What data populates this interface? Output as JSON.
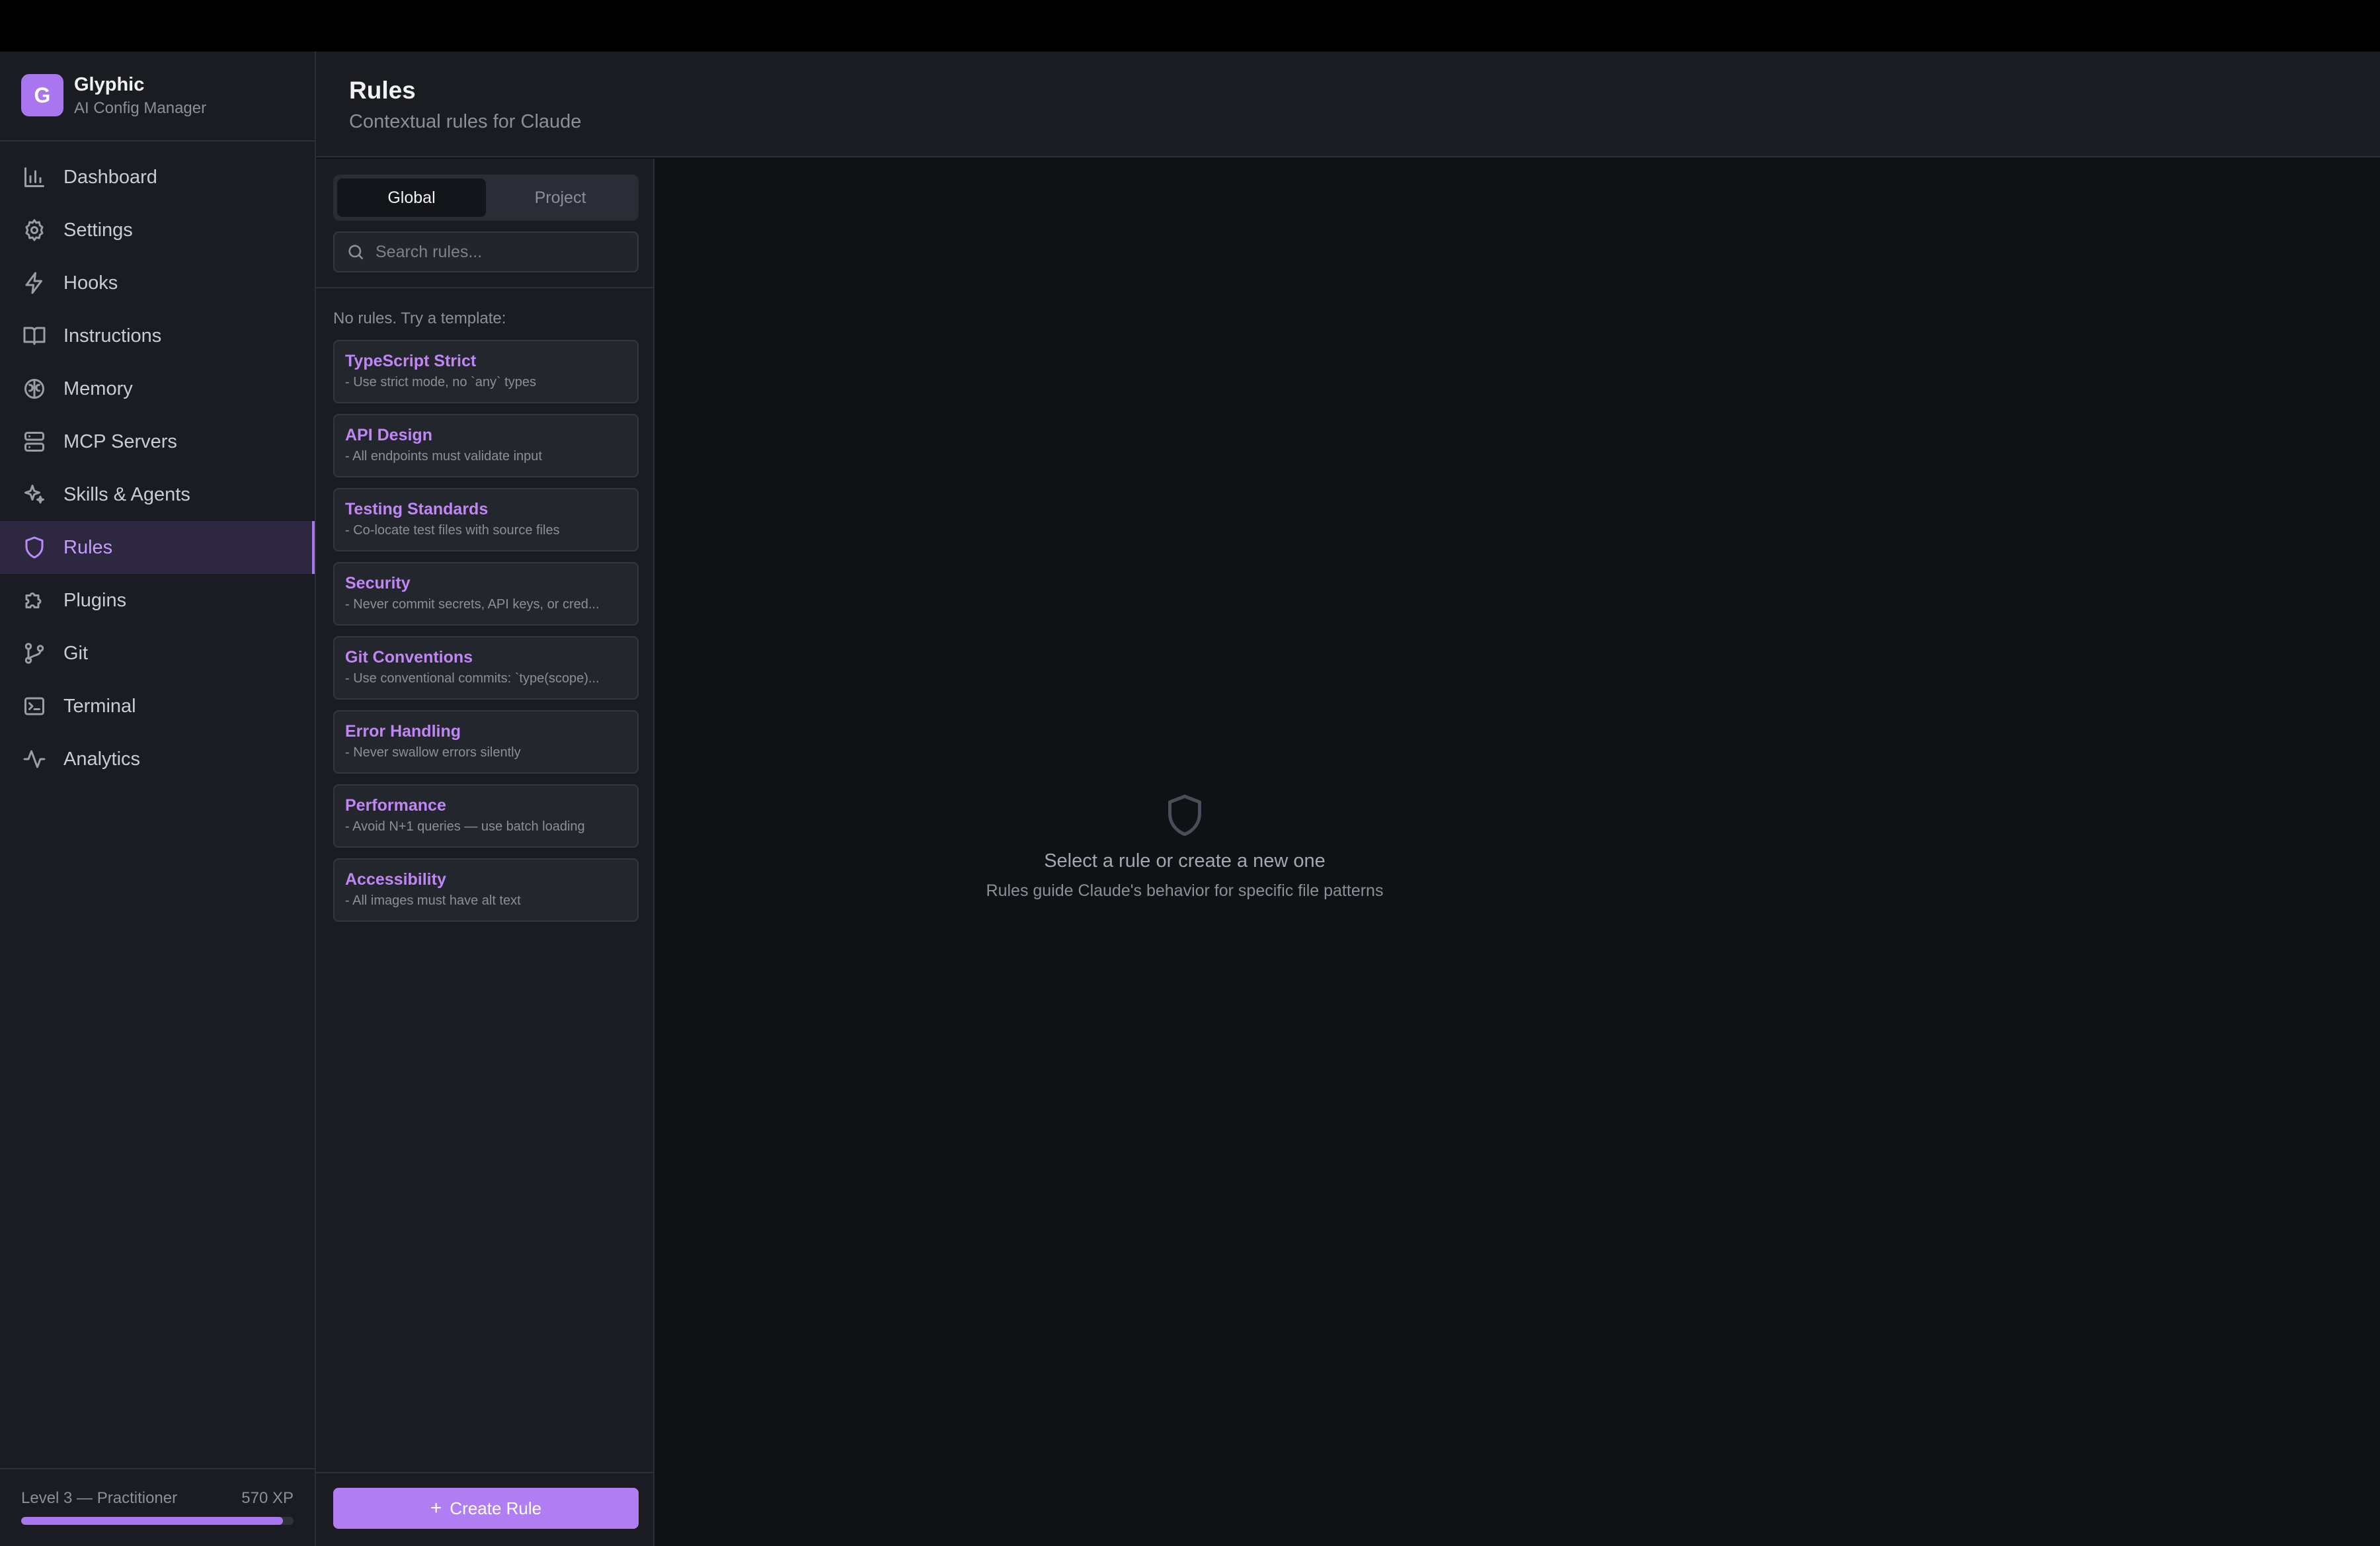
{
  "app": {
    "logo_letter": "G",
    "name": "Glyphic",
    "subtitle": "AI Config Manager"
  },
  "nav": [
    {
      "label": "Dashboard",
      "icon": "bar-chart-icon",
      "active": false
    },
    {
      "label": "Settings",
      "icon": "gear-icon",
      "active": false
    },
    {
      "label": "Hooks",
      "icon": "lightning-icon",
      "active": false
    },
    {
      "label": "Instructions",
      "icon": "book-icon",
      "active": false
    },
    {
      "label": "Memory",
      "icon": "brain-icon",
      "active": false
    },
    {
      "label": "MCP Servers",
      "icon": "server-icon",
      "active": false
    },
    {
      "label": "Skills & Agents",
      "icon": "sparkles-icon",
      "active": false
    },
    {
      "label": "Rules",
      "icon": "shield-icon",
      "active": true
    },
    {
      "label": "Plugins",
      "icon": "puzzle-icon",
      "active": false
    },
    {
      "label": "Git",
      "icon": "git-branch-icon",
      "active": false
    },
    {
      "label": "Terminal",
      "icon": "terminal-icon",
      "active": false
    },
    {
      "label": "Analytics",
      "icon": "activity-icon",
      "active": false
    }
  ],
  "xp": {
    "level_label": "Level 3 — Practitioner",
    "xp_label": "570 XP",
    "progress": 0.96
  },
  "header": {
    "title": "Rules",
    "subtitle": "Contextual rules for Claude"
  },
  "scope_tabs": {
    "global": "Global",
    "project": "Project",
    "selected": "Global"
  },
  "search": {
    "placeholder": "Search rules...",
    "value": ""
  },
  "rules_panel": {
    "empty_hint": "No rules. Try a template:",
    "templates": [
      {
        "title": "TypeScript Strict",
        "desc": "- Use strict mode, no `any` types"
      },
      {
        "title": "API Design",
        "desc": "- All endpoints must validate input"
      },
      {
        "title": "Testing Standards",
        "desc": "- Co-locate test files with source files"
      },
      {
        "title": "Security",
        "desc": "- Never commit secrets, API keys, or cred..."
      },
      {
        "title": "Git Conventions",
        "desc": "- Use conventional commits: `type(scope)..."
      },
      {
        "title": "Error Handling",
        "desc": "- Never swallow errors silently"
      },
      {
        "title": "Performance",
        "desc": "- Avoid N+1 queries — use batch loading"
      },
      {
        "title": "Accessibility",
        "desc": "- All images must have alt text"
      }
    ],
    "create_label": "Create Rule"
  },
  "empty_state": {
    "icon": "shield-icon",
    "title": "Select a rule or create a new one",
    "subtitle": "Rules guide Claude's behavior for specific file patterns"
  },
  "colors": {
    "accent": "#a877f0",
    "background": "#0f1115",
    "panel": "#1a1c22"
  }
}
